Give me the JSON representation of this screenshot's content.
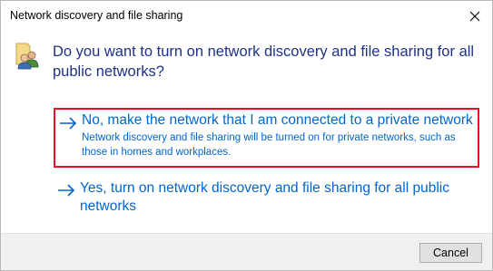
{
  "window": {
    "title": "Network discovery and file sharing",
    "close_icon": "close-icon"
  },
  "header": {
    "icon": "network-users-icon",
    "question": "Do you want to turn on network discovery and file sharing for all public networks?"
  },
  "options": [
    {
      "icon": "arrow-right-icon",
      "label": "No, make the network that I am connected to a private network",
      "description": "Network discovery and file sharing will be turned on for private networks, such as those in homes and workplaces.",
      "highlighted": true
    },
    {
      "icon": "arrow-right-icon",
      "label": "Yes, turn on network discovery and file sharing for all public networks"
    }
  ],
  "footer": {
    "cancel_label": "Cancel"
  },
  "colors": {
    "link": "#0066cc",
    "question": "#1e3287",
    "highlight_border": "#e81123",
    "footer_bg": "#f0f0f0"
  }
}
